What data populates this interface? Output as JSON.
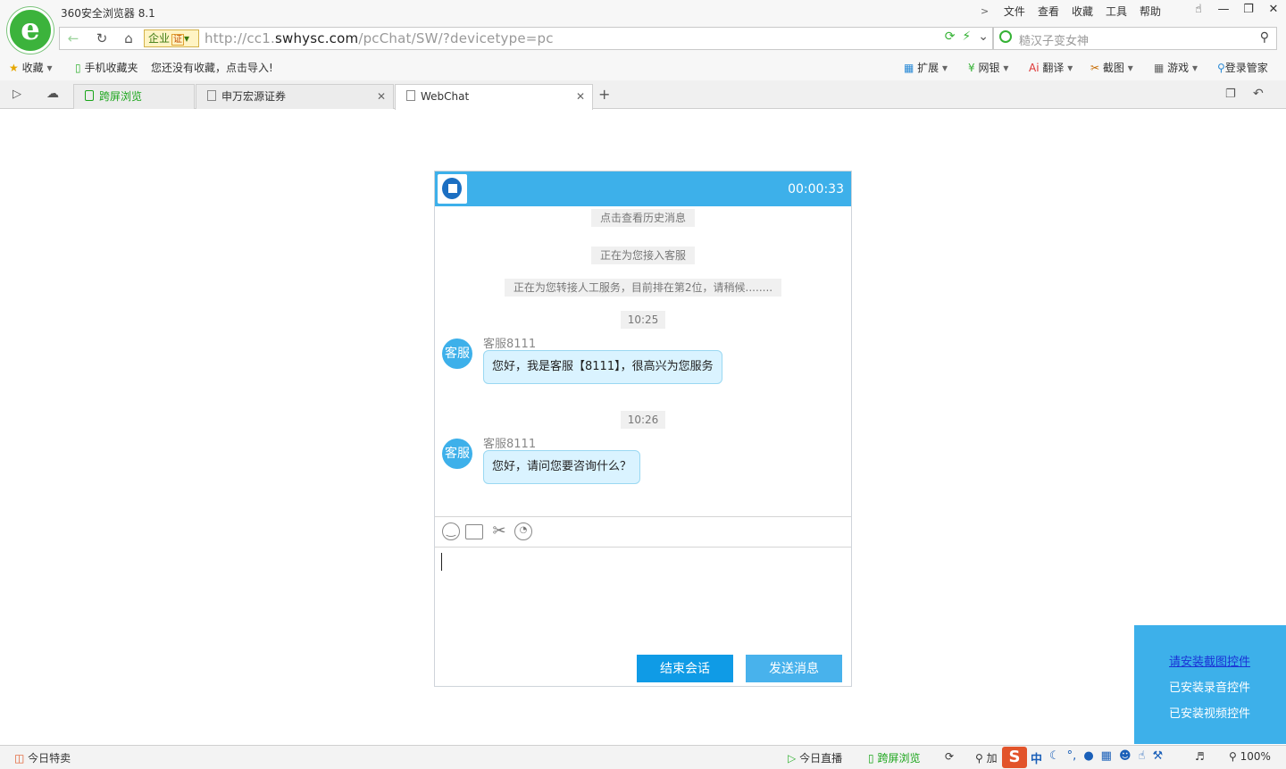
{
  "browser": {
    "app_title": "360安全浏览器 8.1",
    "menu": [
      "文件",
      "查看",
      "收藏",
      "工具",
      "帮助"
    ],
    "nav": {
      "enterprise_label": "企业",
      "cert_label": "证",
      "url_prefix": "http://cc1.",
      "url_domain": "swhysc.com",
      "url_path": "/pcChat/SW/?devicetype=pc",
      "search_placeholder": "糙汉子变女神"
    },
    "bookmarks": {
      "favorites": "收藏",
      "mobile_favorites": "手机收藏夹",
      "empty_hint": "您还没有收藏，点击导入!",
      "extensions": [
        "扩展",
        "网银",
        "翻译",
        "截图",
        "游戏",
        "登录管家"
      ]
    },
    "tabs": [
      {
        "label": "跨屏浏览"
      },
      {
        "label": "申万宏源证券"
      },
      {
        "label": "WebChat"
      }
    ]
  },
  "chat": {
    "timer": "00:00:33",
    "history_link": "点击查看历史消息",
    "connecting": "正在为您接入客服",
    "queue": "正在为您转接人工服务，目前排在第2位，请稍候........",
    "messages": [
      {
        "time": "10:25",
        "avatar": "客服",
        "sender": "客服8111",
        "text": "您好，我是客服【8111】，很高兴为您服务"
      },
      {
        "time": "10:26",
        "avatar": "客服",
        "sender": "客服8111",
        "text": "您好，请问您要咨询什么？"
      }
    ],
    "end_button": "结束会话",
    "send_button": "发送消息"
  },
  "plugins": {
    "screenshot": "请安装截图控件",
    "audio": "已安装录音控件",
    "video": "已安装视频控件"
  },
  "statusbar": {
    "deals": "今日特卖",
    "live": "今日直播",
    "cross_screen": "跨屏浏览",
    "zoom": "100%",
    "ime_lang": "中",
    "truncated": "加"
  }
}
